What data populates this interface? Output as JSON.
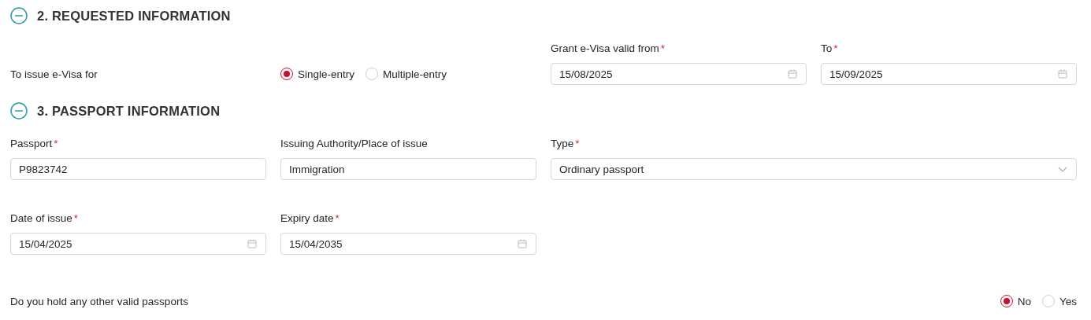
{
  "sections": [
    {
      "title": "2. REQUESTED INFORMATION",
      "expanded": true,
      "rows": [
        [
          {
            "kind": "radio_group",
            "label": "To issue e-Visa for",
            "options": [
              {
                "label": "Single-entry",
                "selected": true
              },
              {
                "label": "Multiple-entry",
                "selected": false
              }
            ]
          },
          {
            "kind": "date",
            "label": "Grant e-Visa valid from",
            "required_mark": "*",
            "value": "15/08/2025"
          },
          {
            "kind": "date",
            "label": "To",
            "required_mark": "*",
            "value": "15/09/2025"
          }
        ]
      ]
    },
    {
      "title": "3. PASSPORT INFORMATION",
      "expanded": true,
      "rows": [
        [
          {
            "kind": "text",
            "label": "Passport",
            "required_mark": "*",
            "value": "P9823742"
          },
          {
            "kind": "text",
            "label": "Issuing Authority/Place of issue",
            "value": "Immigration"
          },
          {
            "kind": "select",
            "label": "Type",
            "required_mark": "*",
            "value": "Ordinary passport"
          }
        ],
        [
          {
            "kind": "date",
            "label": "Date of issue",
            "required_mark": "*",
            "value": "15/04/2025"
          },
          {
            "kind": "date",
            "label": "Expiry date",
            "required_mark": "*",
            "value": "15/04/2035"
          }
        ],
        [
          {
            "kind": "radio_group",
            "label": "Do you hold any other valid passports",
            "options": [
              {
                "label": "No",
                "selected": true
              },
              {
                "label": "Yes",
                "selected": false
              }
            ]
          }
        ]
      ]
    }
  ]
}
